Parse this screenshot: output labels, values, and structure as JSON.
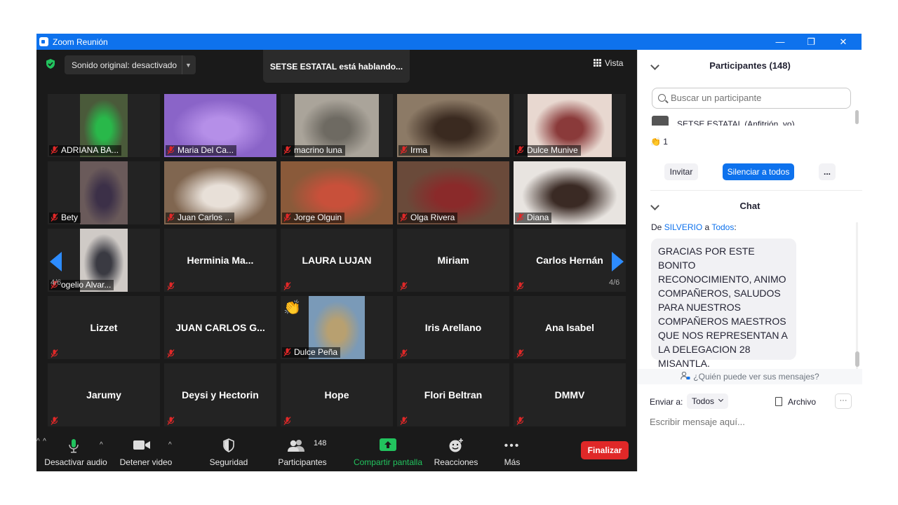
{
  "window": {
    "title": "Zoom Reunión",
    "controls": {
      "minimize": "—",
      "restore": "❐",
      "close": "✕"
    }
  },
  "top_bar": {
    "sound_original": "Sonido original: desactivado",
    "speaking": "SETSE ESTATAL está hablando...",
    "view": "Vista"
  },
  "gallery": {
    "page_left": "4/6",
    "page_right": "4/6",
    "rows": [
      [
        {
          "name": "ADRIANA BA...",
          "video": true,
          "color": "#4a5a3a",
          "accent": "#29b84a"
        },
        {
          "name": "Maria Del Ca...",
          "video": true,
          "color": "#8a64c8",
          "accent": "#b58fe8"
        },
        {
          "name": "macrino  luna",
          "video": true,
          "color": "#aaa49a",
          "accent": "#6e6a62"
        },
        {
          "name": "Irma",
          "video": true,
          "color": "#8c7a66",
          "accent": "#3a2a20"
        },
        {
          "name": "Dulce Munive",
          "video": true,
          "color": "#e8d8d0",
          "accent": "#8a3a3a"
        }
      ],
      [
        {
          "name": "Bety",
          "video": true,
          "color": "#6a5a5a",
          "accent": "#3c3048"
        },
        {
          "name": "Juan Carlos ...",
          "video": true,
          "color": "#806650",
          "accent": "#e8e0d8"
        },
        {
          "name": "Jorge Olguin",
          "video": true,
          "color": "#8a5a3a",
          "accent": "#c8503a"
        },
        {
          "name": "Olga Rivera",
          "video": true,
          "color": "#6a4a3a",
          "accent": "#8a2a2a"
        },
        {
          "name": "Diana",
          "video": true,
          "color": "#e8e4e0",
          "accent": "#3a2a24"
        }
      ],
      [
        {
          "name": "ogelio Alvar...",
          "video": true,
          "color": "#cfcac6",
          "accent": "#3a3a42"
        },
        {
          "name": "Herminia Ma...",
          "video": false
        },
        {
          "name": "LAURA LUJAN",
          "video": false
        },
        {
          "name": "Miriam",
          "video": false
        },
        {
          "name": "Carlos Hernán",
          "video": false
        }
      ],
      [
        {
          "name": "Lizzet",
          "video": false
        },
        {
          "name": "JUAN CARLOS G...",
          "video": false
        },
        {
          "name": "Dulce Peña",
          "video": true,
          "color": "#7a9ab8",
          "accent": "#b8a070"
        },
        {
          "name": "Iris Arellano",
          "video": false
        },
        {
          "name": "Ana Isabel",
          "video": false
        }
      ],
      [
        {
          "name": "Jarumy",
          "video": false
        },
        {
          "name": "Deysi y Hectorin",
          "video": false
        },
        {
          "name": "Hope",
          "video": false
        },
        {
          "name": "Flori Beltran",
          "video": false
        },
        {
          "name": "DMMV",
          "video": false
        }
      ]
    ],
    "raised_reaction": "👏"
  },
  "toolbar": {
    "mute": "Desactivar audio",
    "video": "Detener video",
    "security": "Seguridad",
    "participants": "Participantes",
    "participants_count": "148",
    "share": "Compartir pantalla",
    "reactions": "Reacciones",
    "more": "Más",
    "end": "Finalizar"
  },
  "participants_panel": {
    "title": "Participantes (148)",
    "search_placeholder": "Buscar un participante",
    "host_row": "SETSE ESTATAL (Anfitrión, yo)",
    "reaction": "👏",
    "reaction_count": "1",
    "invite": "Invitar",
    "mute_all": "Silenciar a todos",
    "more": "..."
  },
  "chat": {
    "title": "Chat",
    "from_prefix": "De",
    "sender": "SILVERIO",
    "to_word": "a",
    "recipient": "Todos",
    "recipient_suffix": ":",
    "message": "GRACIAS POR ESTE BONITO RECONOCIMIENTO, ANIMO COMPAÑEROS, SALUDOS PARA NUESTROS COMPAÑEROS MAESTROS QUE NOS REPRESENTAN A LA DELEGACION 28 MISANTLA.",
    "who_can_see": "¿Quién puede ver sus mensajes?",
    "send_to_label": "Enviar a:",
    "send_to_value": "Todos",
    "file": "Archivo",
    "more": "···",
    "input_placeholder": "Escribir mensaje aquí..."
  },
  "colors": {
    "zoom_blue": "#0e72ed",
    "nav_blue": "#2d8cff",
    "share_green": "#22c35e",
    "end_red": "#e02828",
    "mute_red": "#e02828"
  }
}
